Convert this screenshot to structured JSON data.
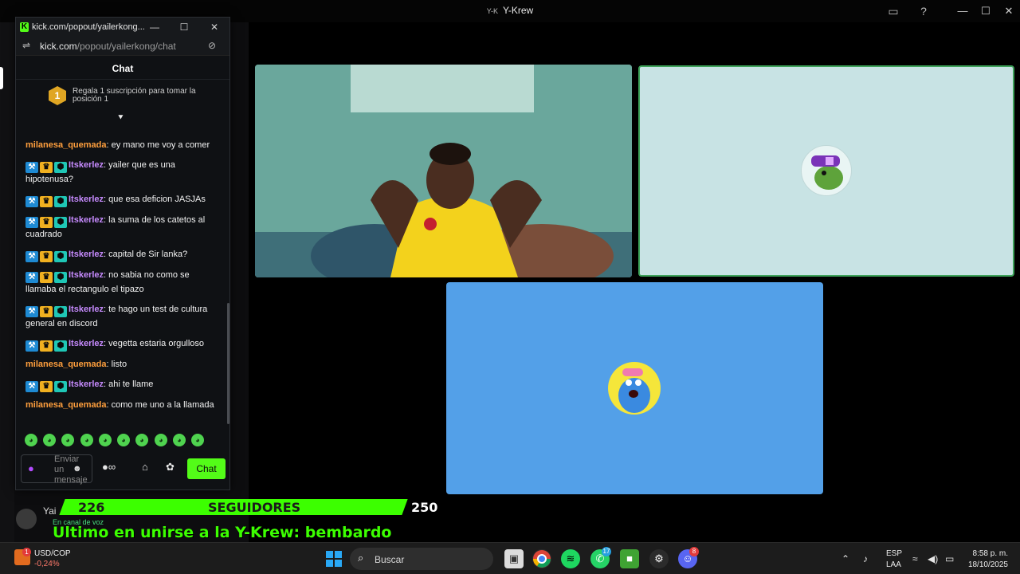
{
  "app": {
    "title_prefix": "Y-K",
    "title": "Y-Krew"
  },
  "chat_window": {
    "url_title": "kick.com/popout/yailerkong...",
    "url_host": "kick.com",
    "url_path": "/popout/yailerkong/chat",
    "header": "Chat",
    "promo_rank": "1",
    "promo_text": "Regala 1 suscripción para tomar la posición 1",
    "messages": [
      {
        "user": "milanesa_quemada",
        "color": "#ff9f3d",
        "badges": false,
        "text": ": ey mano me voy a comer"
      },
      {
        "user": "Itskerlez",
        "color": "#c78bff",
        "badges": true,
        "text": ": yailer que es una hipotenusa?"
      },
      {
        "user": "Itskerlez",
        "color": "#c78bff",
        "badges": true,
        "text": ": que esa deficion JASJAs"
      },
      {
        "user": "Itskerlez",
        "color": "#c78bff",
        "badges": true,
        "text": ": la suma de los catetos al cuadrado"
      },
      {
        "user": "Itskerlez",
        "color": "#c78bff",
        "badges": true,
        "text": ": capital de Sir lanka?"
      },
      {
        "user": "Itskerlez",
        "color": "#c78bff",
        "badges": true,
        "text": ": no sabia no como se llamaba el rectangulo el tipazo"
      },
      {
        "user": "Itskerlez",
        "color": "#c78bff",
        "badges": true,
        "text": ": te hago un test de cultura general en discord"
      },
      {
        "user": "Itskerlez",
        "color": "#c78bff",
        "badges": true,
        "text": ": vegetta estaria orgulloso"
      },
      {
        "user": "milanesa_quemada",
        "color": "#ff9f3d",
        "badges": false,
        "text": ": listo"
      },
      {
        "user": "Itskerlez",
        "color": "#c78bff",
        "badges": true,
        "text": ": ahi te llame"
      },
      {
        "user": "milanesa_quemada",
        "color": "#ff9f3d",
        "badges": false,
        "text": ": como me uno a la llamada"
      }
    ],
    "input_placeholder": "Enviar un mensaje",
    "send_label": "Chat"
  },
  "voice_user": {
    "name": "Yai",
    "status": "En canal de voz"
  },
  "overlay": {
    "followers_current": "226",
    "followers_label": "SEGUIDORES",
    "followers_goal": "250",
    "followers_progress": 0.904,
    "last_join": "Ultimo en unirse a la Y-Krew: bembardo"
  },
  "taskbar": {
    "widget_badge": "1",
    "widget_title": "USD/COP",
    "widget_change": "-0,24%",
    "search_placeholder": "Buscar",
    "whatsapp_badge": "17",
    "discord_badge": "8",
    "lang_top": "ESP",
    "lang_bottom": "LAA",
    "time": "8:58 p. m.",
    "date": "18/10/2025"
  }
}
